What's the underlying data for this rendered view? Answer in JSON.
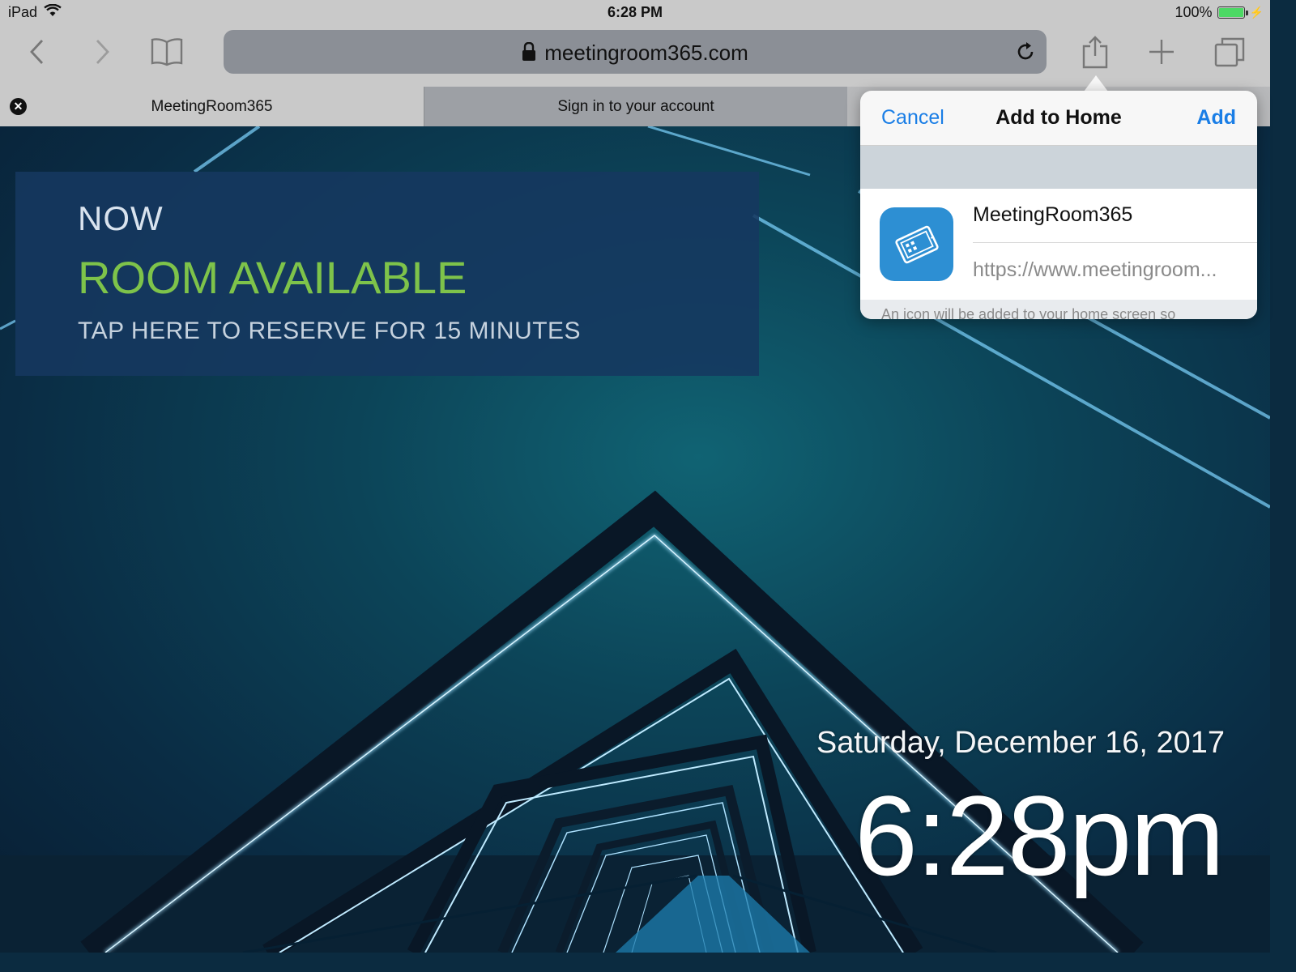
{
  "status_bar": {
    "device": "iPad",
    "time": "6:28 PM",
    "battery": "100%",
    "battery_level": 1.0
  },
  "toolbar": {
    "url": "meetingroom365.com",
    "icons": [
      "back-icon",
      "forward-icon",
      "bookmarks-icon",
      "lock-icon",
      "reload-icon",
      "share-icon",
      "new-tab-icon",
      "tabs-icon"
    ]
  },
  "tabs": [
    {
      "label": "MeetingRoom365",
      "active": true
    },
    {
      "label": "Sign in to your account",
      "active": false
    }
  ],
  "page": {
    "now": "NOW",
    "status": "ROOM AVAILABLE",
    "action": "TAP HERE TO RESERVE FOR 15 MINUTES",
    "date": "Saturday, December 16, 2017",
    "clock": "6:28pm",
    "status_color": "#7ec34a"
  },
  "add_to_home": {
    "cancel": "Cancel",
    "title": "Add to Home",
    "add": "Add",
    "app_name": "MeetingRoom365",
    "app_url": "https://www.meetingroom...",
    "footer": "An icon will be added to your home screen so",
    "accent_color": "#1a7ee6"
  }
}
